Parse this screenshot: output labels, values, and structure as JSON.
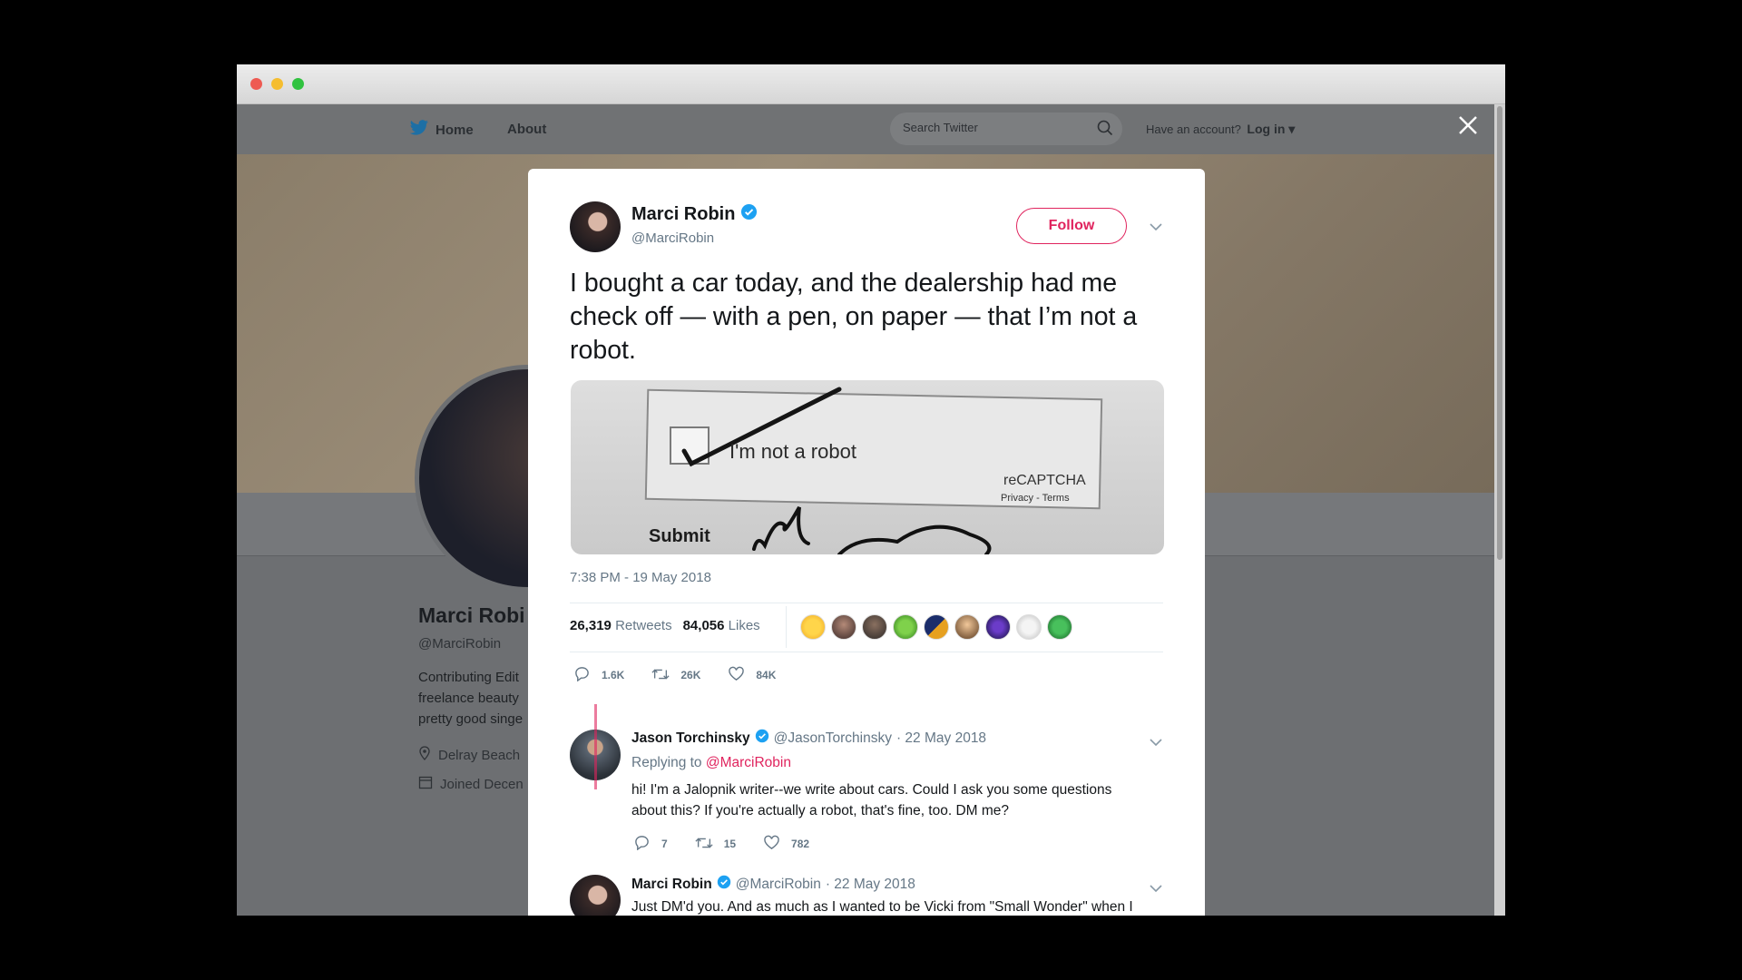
{
  "nav": {
    "home": "Home",
    "about": "About",
    "search_placeholder": "Search Twitter",
    "account_prompt": "Have an account?",
    "login": "Log in"
  },
  "profile": {
    "name": "Marci Robi",
    "handle": "@MarciRobin",
    "bio_lines": [
      "Contributing Edit",
      "freelance beauty",
      "pretty good singe"
    ],
    "location": "Delray Beach",
    "joined": "Joined Decen"
  },
  "tweet": {
    "author_name": "Marci Robin",
    "author_handle": "@MarciRobin",
    "follow_label": "Follow",
    "text": "I bought a car today, and the dealership had me check off — with a pen, on paper — that I’m not a robot.",
    "media": {
      "checkbox_label": "I'm not a robot",
      "brand": "reCAPTCHA",
      "links": "Privacy - Terms",
      "submit": "Submit"
    },
    "timestamp": "7:38 PM - 19 May 2018",
    "retweets_count": "26,319",
    "retweets_label": "Retweets",
    "likes_count": "84,056",
    "likes_label": "Likes",
    "reply_count": "1.6K",
    "retweet_short": "26K",
    "like_short": "84K"
  },
  "replies": [
    {
      "name": "Jason Torchinsky",
      "handle": "@JasonTorchinsky",
      "date": "· 22 May 2018",
      "replying_prefix": "Replying to",
      "replying_to": "@MarciRobin",
      "text_lines": [
        "hi! I'm a Jalopnik writer--we write about cars. Could I ask you some questions",
        "about this? If you're actually a robot, that's fine, too. DM me?"
      ],
      "reply_count": "7",
      "retweet_count": "15",
      "like_count": "782"
    },
    {
      "name": "Marci Robin",
      "handle": "@MarciRobin",
      "date": "· 22 May 2018",
      "text_lines": [
        "Just DM'd you. And as much as I wanted to be Vicki from \"Small Wonder\" when I"
      ]
    }
  ],
  "colors": {
    "accent": "#e0245e",
    "verified": "#1da1f2",
    "twitter_blue": "#1da1f2"
  }
}
